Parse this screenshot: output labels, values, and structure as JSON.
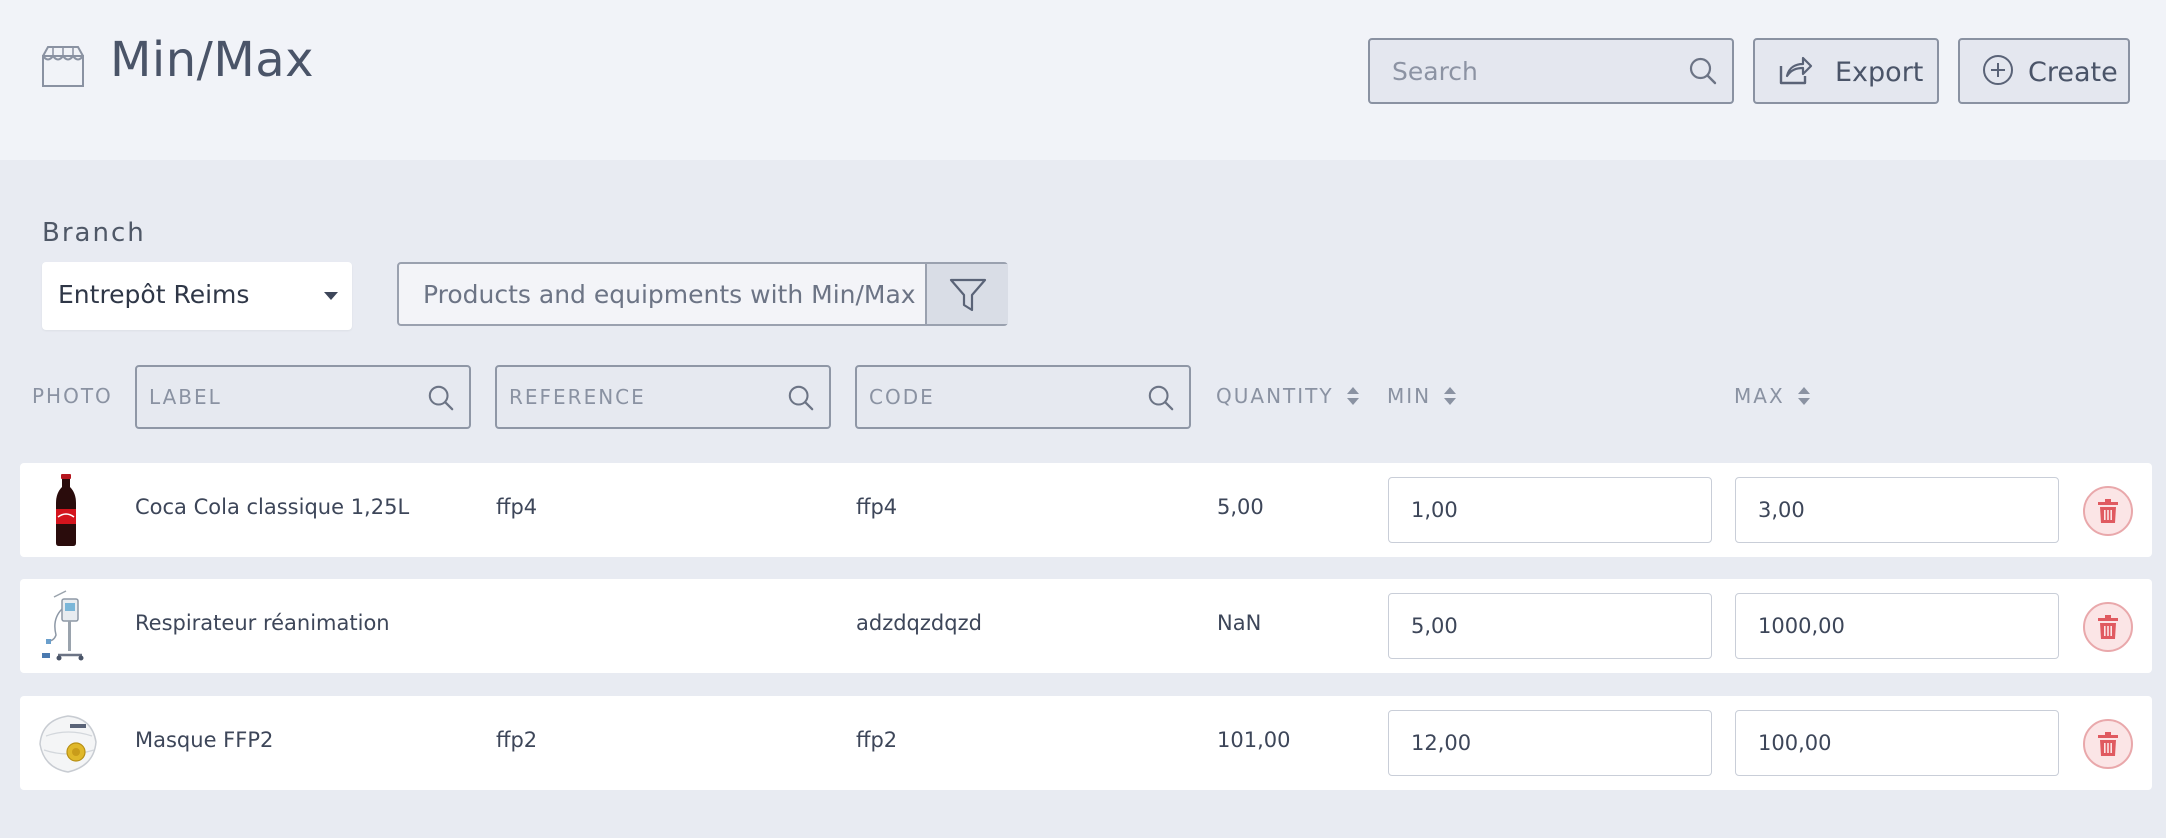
{
  "header": {
    "title": "Min/Max",
    "icon": "store-icon",
    "search": {
      "placeholder": "Search",
      "value": ""
    },
    "export_label": "Export",
    "create_label": "Create"
  },
  "filters": {
    "branch_label": "Branch",
    "branch_value": "Entrepôt Reims",
    "product_filter_text": "Products and equipments with Min/Max"
  },
  "table": {
    "columns": {
      "photo": "PHOTO",
      "label": "LABEL",
      "reference": "REFERENCE",
      "code": "CODE",
      "quantity": "QUANTITY",
      "min": "MIN",
      "max": "MAX"
    },
    "rows": [
      {
        "photo": "coca-cola-bottle",
        "label": "Coca Cola classique 1,25L",
        "reference": "ffp4",
        "code": "ffp4",
        "quantity": "5,00",
        "min": "1,00",
        "max": "3,00"
      },
      {
        "photo": "ventilator-machine",
        "label": "Respirateur réanimation",
        "reference": "",
        "code": "adzdqzdqzd",
        "quantity": "NaN",
        "min": "5,00",
        "max": "1000,00"
      },
      {
        "photo": "ffp2-mask",
        "label": "Masque FFP2",
        "reference": "ffp2",
        "code": "ffp2",
        "quantity": "101,00",
        "min": "12,00",
        "max": "100,00"
      }
    ]
  },
  "colors": {
    "header_bg": "#f1f3f8",
    "page_bg": "#e8ebf2",
    "text": "#3d4659",
    "muted": "#8a92a2",
    "delete_red": "#e05a60"
  }
}
